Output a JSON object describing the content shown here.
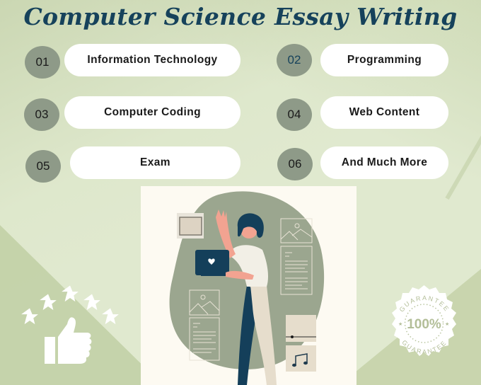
{
  "title": "Computer Science  Essay Writing",
  "colors": {
    "title": "#16425b",
    "number_circle": "#8e9a88",
    "pill": "#ffffff",
    "background": "#e0e9cf",
    "illustration_blob": "#9ba68f",
    "laptop": "#143f5a",
    "skin": "#f2a391",
    "panel": "#fdfaf2"
  },
  "topics": [
    {
      "number": "01",
      "label": "Information Technology"
    },
    {
      "number": "02",
      "label": "Programming"
    },
    {
      "number": "03",
      "label": "Computer Coding"
    },
    {
      "number": "04",
      "label": "Web Content"
    },
    {
      "number": "05",
      "label": "Exam"
    },
    {
      "number": "06",
      "label": "And Much More"
    }
  ],
  "rating": {
    "stars": 5,
    "icon": "thumbs-up-icon"
  },
  "badge": {
    "top_text": "GUARANTEE",
    "center_text": "100%",
    "bottom_text": "GUARANTEE"
  }
}
